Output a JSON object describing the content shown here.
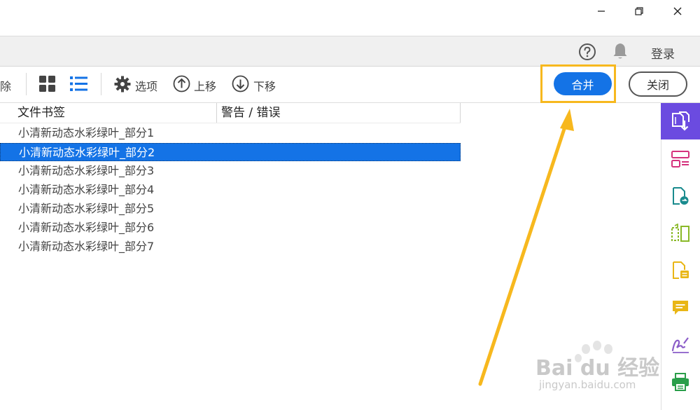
{
  "window_controls": {
    "minimize_icon": "minimize-icon",
    "restore_icon": "restore-icon",
    "close_icon": "close-icon"
  },
  "header": {
    "help_icon": "help-circle-icon",
    "bell_icon": "bell-icon",
    "login_label": "登录"
  },
  "toolbar": {
    "truncated_label": "除",
    "grid_view_icon": "grid-view-icon",
    "list_view_icon": "list-view-icon",
    "options_label": "选项",
    "move_up_label": "上移",
    "move_down_label": "下移",
    "merge_label": "合并",
    "close_label": "关闭"
  },
  "table": {
    "columns": [
      "文件书签",
      "警告 / 错误"
    ],
    "rows": [
      "小清新动态水彩绿叶_部分1",
      "小清新动态水彩绿叶_部分2",
      "小清新动态水彩绿叶_部分3",
      "小清新动态水彩绿叶_部分4",
      "小清新动态水彩绿叶_部分5",
      "小清新动态水彩绿叶_部分6",
      "小清新动态水彩绿叶_部分7"
    ],
    "selected_index": 1
  },
  "sidebar": {
    "items": [
      "combine-files-icon",
      "organize-pages-icon",
      "export-pdf-icon",
      "compress-pages-icon",
      "edit-pdf-icon",
      "comment-icon",
      "fill-sign-icon",
      "print-production-icon"
    ]
  },
  "colors": {
    "accent": "#1473e6",
    "highlight": "#f7b81e",
    "sidebar_active": "#6b4be0"
  },
  "watermark": {
    "main": "Bai du 经验",
    "sub": "jingyan.baidu.com"
  }
}
